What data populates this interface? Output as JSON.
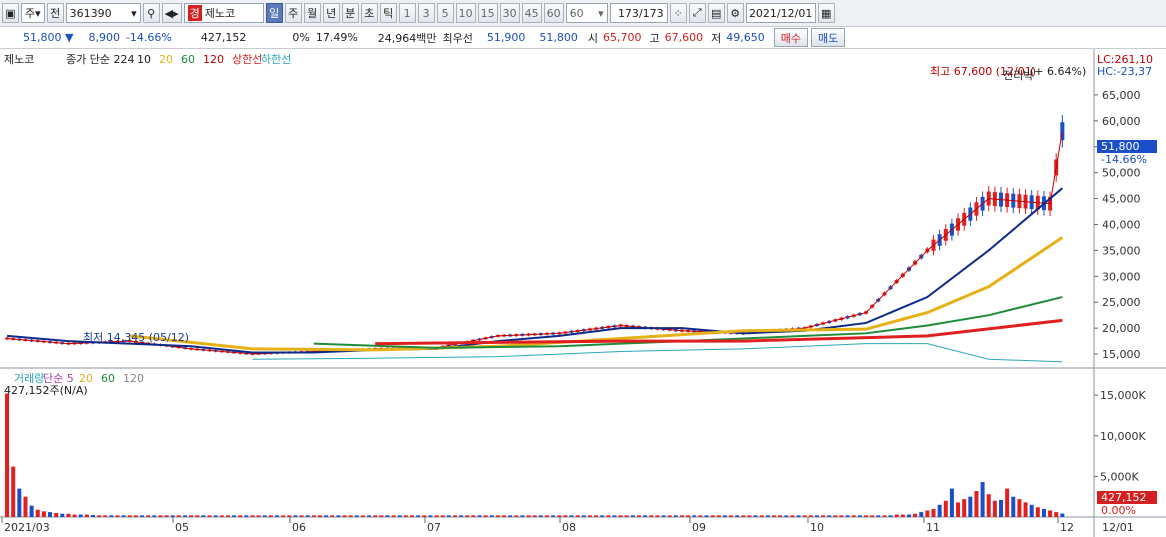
{
  "toolbar": {
    "market": "주",
    "prev": "전",
    "code": "361390",
    "name_badge": "경",
    "name": "제노코",
    "periods": [
      "일",
      "주",
      "월",
      "년",
      "분",
      "초",
      "틱"
    ],
    "active_period": "일",
    "intervals": [
      "1",
      "3",
      "5",
      "10",
      "15",
      "30",
      "45",
      "60"
    ],
    "interval_select": "60",
    "count": "173",
    "total": "/173",
    "date": "2021/12/01"
  },
  "info": {
    "price": "51,800 ▼",
    "change": "8,900",
    "change_pct": "-14.66%",
    "volume": "427,152",
    "ratio1": "0%",
    "ratio2": "17.49%",
    "amount": "24,964백만",
    "ask_label": "최우선",
    "ask1": "51,900",
    "ask2": "51,800",
    "open_label": "시",
    "open": "65,700",
    "high_label": "고",
    "high": "67,600",
    "low_label": "저",
    "low": "49,650",
    "buy": "매수",
    "sell": "매도"
  },
  "colors": {
    "up": "#e02020",
    "down": "#1a4fc8",
    "ma10": "#c00000",
    "ma20": "#0b2a8a",
    "ma60": "#e6b116",
    "ma120": "#1e8c3a",
    "upper": "#e02020",
    "lower": "#2aa7b8"
  },
  "chart_data": {
    "type": "line",
    "title": "제노코",
    "legend": [
      "종가 단순 224",
      "10",
      "20",
      "60",
      "120",
      "상한선",
      "하한선"
    ],
    "x_ticks": [
      "2021/03",
      "05",
      "06",
      "07",
      "08",
      "09",
      "10",
      "11",
      "12"
    ],
    "y_ticks": [
      "65,000",
      "60,000",
      "55,000",
      "50,000",
      "45,000",
      "40,000",
      "35,000",
      "30,000",
      "25,000",
      "20,000",
      "15,000"
    ],
    "ylim": [
      12500,
      70000
    ],
    "annotations": {
      "max_label": "최고 67,600 (12/01)",
      "max_pct": "(+ 6.64%)",
      "min_label": "최저 14,345 (05/12)",
      "top_overlay": "전리박",
      "lc": "LC:261,10",
      "hc": "HC:-23,37",
      "last_price": "51,800",
      "last_pct": "-14.66%"
    },
    "series": [
      {
        "name": "10",
        "x": [
          0,
          10,
          20,
          30,
          40,
          50,
          60,
          70,
          80,
          90,
          100,
          110,
          120,
          130,
          140,
          150,
          160,
          170,
          172
        ],
        "values": [
          18000,
          17000,
          17500,
          16000,
          15000,
          15500,
          16000,
          16200,
          18500,
          19000,
          20500,
          19500,
          19000,
          20000,
          23000,
          35000,
          45000,
          44000,
          58000
        ]
      },
      {
        "name": "20",
        "x": [
          0,
          10,
          20,
          30,
          40,
          50,
          60,
          70,
          80,
          90,
          100,
          110,
          120,
          130,
          140,
          150,
          160,
          170,
          172
        ],
        "values": [
          18500,
          17500,
          17000,
          16500,
          15300,
          15300,
          15800,
          16000,
          17500,
          18500,
          20000,
          20000,
          19000,
          19500,
          21000,
          26000,
          35000,
          45000,
          47000
        ]
      },
      {
        "name": "60",
        "x": [
          20,
          40,
          60,
          80,
          100,
          120,
          140,
          150,
          160,
          172
        ],
        "values": [
          18500,
          16000,
          15800,
          16500,
          18000,
          19500,
          19800,
          23000,
          28000,
          37500
        ]
      },
      {
        "name": "120",
        "x": [
          50,
          70,
          90,
          110,
          130,
          140,
          150,
          160,
          172
        ],
        "values": [
          17000,
          16200,
          16500,
          17500,
          18500,
          19000,
          20500,
          22500,
          26000
        ]
      },
      {
        "name": "상한선",
        "x": [
          60,
          100,
          120,
          150,
          172
        ],
        "values": [
          17000,
          17500,
          17500,
          18500,
          21500
        ]
      },
      {
        "name": "하한선",
        "x": [
          40,
          60,
          80,
          100,
          120,
          140,
          150,
          160,
          172
        ],
        "values": [
          14000,
          14200,
          14500,
          15500,
          16000,
          17000,
          17000,
          14000,
          13500
        ]
      }
    ]
  },
  "volume_data": {
    "legend": [
      "거래량",
      "단순 5",
      "20",
      "60",
      "120"
    ],
    "current": "427,152주(N/A)",
    "y_ticks": [
      "15,000K",
      "10,000K",
      "5,000K"
    ],
    "last_volume": "427,152",
    "last_pct": "0.00%",
    "values": [
      15200,
      6200,
      3500,
      2500,
      1400,
      900,
      700,
      600,
      500,
      400,
      400,
      300,
      300,
      300,
      250,
      200,
      200,
      200,
      200,
      200,
      200,
      200,
      200,
      200,
      200,
      200,
      200,
      200,
      200,
      200,
      200,
      200,
      200,
      200,
      200,
      200,
      200,
      200,
      200,
      200,
      200,
      200,
      200,
      200,
      200,
      200,
      200,
      200,
      200,
      200,
      200,
      200,
      200,
      200,
      200,
      200,
      200,
      200,
      200,
      200,
      200,
      200,
      200,
      200,
      200,
      200,
      200,
      200,
      200,
      200,
      200,
      200,
      200,
      200,
      200,
      200,
      200,
      200,
      200,
      200,
      200,
      200,
      200,
      200,
      200,
      200,
      200,
      200,
      200,
      200,
      200,
      200,
      200,
      200,
      200,
      200,
      200,
      200,
      200,
      200,
      200,
      200,
      200,
      200,
      200,
      200,
      200,
      200,
      200,
      200,
      200,
      200,
      200,
      200,
      200,
      200,
      200,
      200,
      200,
      200,
      200,
      200,
      200,
      200,
      200,
      200,
      200,
      200,
      200,
      200,
      200,
      200,
      200,
      200,
      200,
      200,
      200,
      200,
      200,
      200,
      200,
      200,
      200,
      200,
      200,
      300,
      300,
      300,
      400,
      600,
      800,
      1000,
      1500,
      2000,
      3500,
      1800,
      2200,
      2500,
      3200,
      4300,
      2800,
      2000,
      2100,
      3500,
      2500,
      2200,
      1800,
      1500,
      1200,
      1000,
      800,
      600,
      427
    ]
  }
}
